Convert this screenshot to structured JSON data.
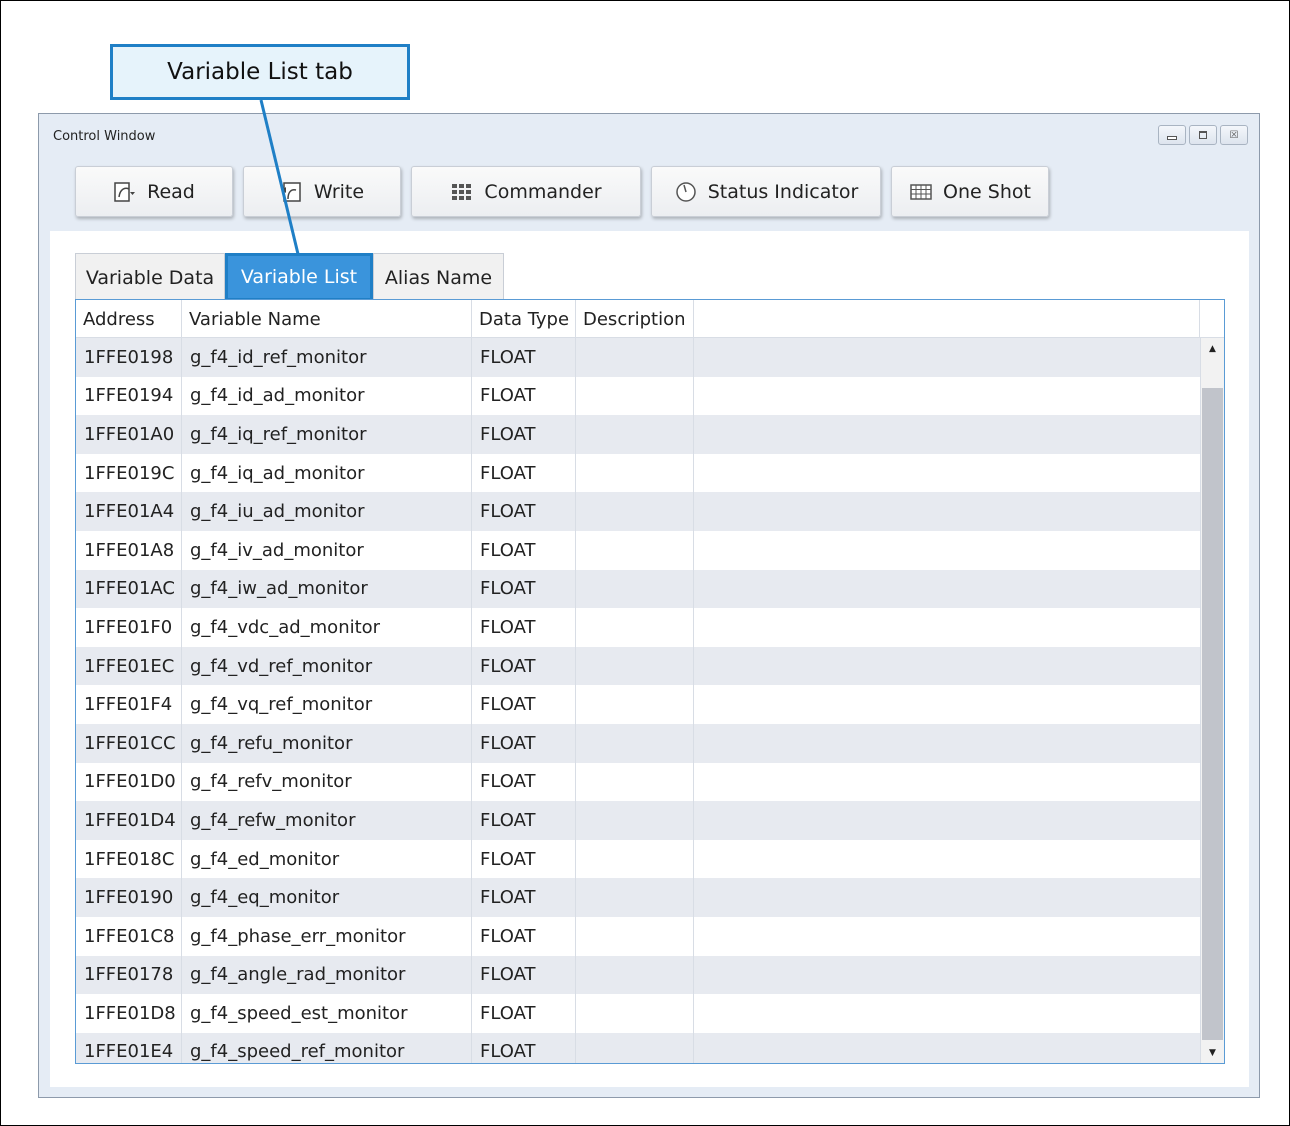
{
  "callout": {
    "label": "Variable List tab"
  },
  "window": {
    "title": "Control Window"
  },
  "toolbar": {
    "buttons": [
      {
        "label": "Read",
        "icon": "read-icon"
      },
      {
        "label": "Write",
        "icon": "write-icon"
      },
      {
        "label": "Commander",
        "icon": "commander-icon"
      },
      {
        "label": "Status Indicator",
        "icon": "status-indicator-icon"
      },
      {
        "label": "One Shot",
        "icon": "one-shot-icon"
      }
    ]
  },
  "tabs": [
    {
      "label": "Variable Data",
      "active": false
    },
    {
      "label": "Variable List",
      "active": true
    },
    {
      "label": "Alias Name",
      "active": false
    }
  ],
  "table": {
    "headers": [
      "Address",
      "Variable Name",
      "Data Type",
      "Description",
      ""
    ],
    "rows": [
      [
        "1FFE0198",
        "g_f4_id_ref_monitor",
        "FLOAT",
        ""
      ],
      [
        "1FFE0194",
        "g_f4_id_ad_monitor",
        "FLOAT",
        ""
      ],
      [
        "1FFE01A0",
        "g_f4_iq_ref_monitor",
        "FLOAT",
        ""
      ],
      [
        "1FFE019C",
        "g_f4_iq_ad_monitor",
        "FLOAT",
        ""
      ],
      [
        "1FFE01A4",
        "g_f4_iu_ad_monitor",
        "FLOAT",
        ""
      ],
      [
        "1FFE01A8",
        "g_f4_iv_ad_monitor",
        "FLOAT",
        ""
      ],
      [
        "1FFE01AC",
        "g_f4_iw_ad_monitor",
        "FLOAT",
        ""
      ],
      [
        "1FFE01F0",
        "g_f4_vdc_ad_monitor",
        "FLOAT",
        ""
      ],
      [
        "1FFE01EC",
        "g_f4_vd_ref_monitor",
        "FLOAT",
        ""
      ],
      [
        "1FFE01F4",
        "g_f4_vq_ref_monitor",
        "FLOAT",
        ""
      ],
      [
        "1FFE01CC",
        "g_f4_refu_monitor",
        "FLOAT",
        ""
      ],
      [
        "1FFE01D0",
        "g_f4_refv_monitor",
        "FLOAT",
        ""
      ],
      [
        "1FFE01D4",
        "g_f4_refw_monitor",
        "FLOAT",
        ""
      ],
      [
        "1FFE018C",
        "g_f4_ed_monitor",
        "FLOAT",
        ""
      ],
      [
        "1FFE0190",
        "g_f4_eq_monitor",
        "FLOAT",
        ""
      ],
      [
        "1FFE01C8",
        "g_f4_phase_err_monitor",
        "FLOAT",
        ""
      ],
      [
        "1FFE0178",
        "g_f4_angle_rad_monitor",
        "FLOAT",
        ""
      ],
      [
        "1FFE01D8",
        "g_f4_speed_est_monitor",
        "FLOAT",
        ""
      ],
      [
        "1FFE01E4",
        "g_f4_speed_ref_monitor",
        "FLOAT",
        ""
      ]
    ]
  },
  "colors": {
    "accent": "#3a94dc",
    "accent_border": "#1f7fc6",
    "window_bg": "#e5ecf5",
    "row_alt": "#e7eaf0"
  }
}
